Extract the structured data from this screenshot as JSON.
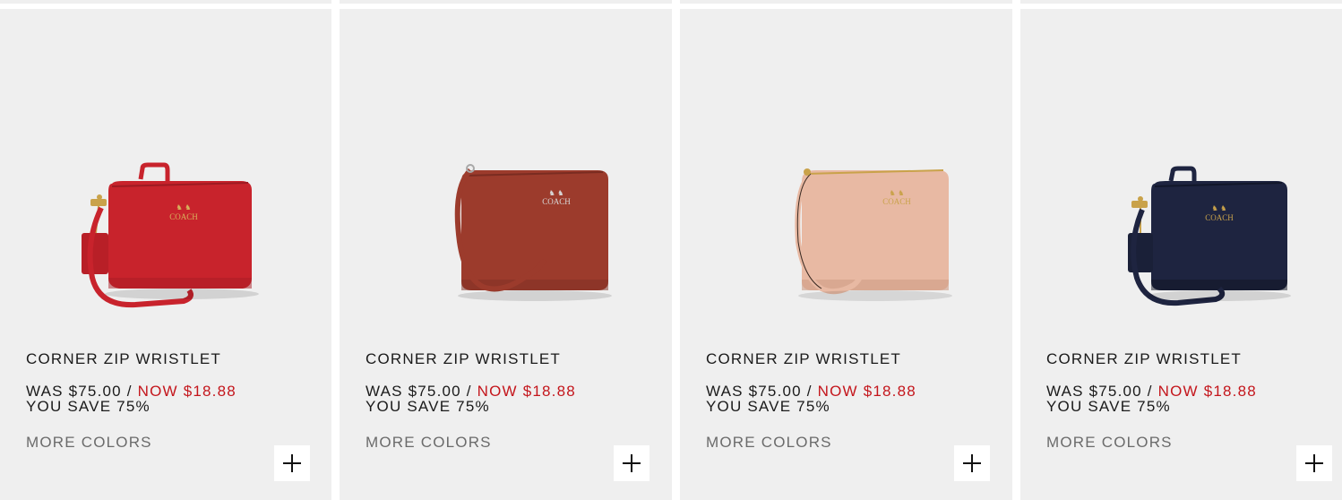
{
  "products": [
    {
      "title": "CORNER ZIP WRISTLET",
      "was_price": "WAS $75.00",
      "separator": "/",
      "now_price": "NOW $18.88",
      "savings": "YOU SAVE 75%",
      "more_colors": "MORE COLORS",
      "body_color": "#c8232c",
      "strap_color": "#c8232c",
      "hardware_color": "#c9a24a",
      "logo_text": "COACH"
    },
    {
      "title": "CORNER ZIP WRISTLET",
      "was_price": "WAS $75.00",
      "separator": "/",
      "now_price": "NOW $18.88",
      "savings": "YOU SAVE 75%",
      "more_colors": "MORE COLORS",
      "body_color": "#9c3b2c",
      "strap_color": "#9c3b2c",
      "hardware_color": "#a8a8a8",
      "logo_text": "COACH"
    },
    {
      "title": "CORNER ZIP WRISTLET",
      "was_price": "WAS $75.00",
      "separator": "/",
      "now_price": "NOW $18.88",
      "savings": "YOU SAVE 75%",
      "more_colors": "MORE COLORS",
      "body_color": "#e8b9a3",
      "strap_color": "#e8b9a3",
      "hardware_color": "#c9a24a",
      "logo_text": "COACH"
    },
    {
      "title": "CORNER ZIP WRISTLET",
      "was_price": "WAS $75.00",
      "separator": "/",
      "now_price": "NOW $18.88",
      "savings": "YOU SAVE 75%",
      "more_colors": "MORE COLORS",
      "body_color": "#1e2440",
      "strap_color": "#1e2440",
      "hardware_color": "#c9a24a",
      "logo_text": "COACH"
    }
  ],
  "colors": {
    "card_bg": "#efefef",
    "sale_red": "#c4161c",
    "muted_text": "#6b6b6b"
  },
  "icons": {
    "add": "plus-icon"
  }
}
